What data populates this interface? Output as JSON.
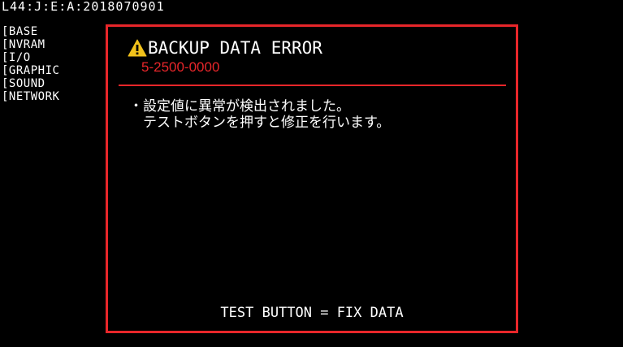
{
  "header": {
    "status_line": "L44:J:E:A:2018070901"
  },
  "menu": {
    "items": [
      {
        "label": "[BASE"
      },
      {
        "label": "[NVRAM"
      },
      {
        "label": "[I/O"
      },
      {
        "label": "[GRAPHIC"
      },
      {
        "label": "[SOUND"
      },
      {
        "label": "[NETWORK"
      }
    ]
  },
  "error_panel": {
    "icon": "warning-icon",
    "title": "BACKUP DATA ERROR",
    "code": "5-2500-0000",
    "message_line1": "・設定値に異常が検出されました。",
    "message_line2": "　テストボタンを押すと修正を行います。",
    "footer": "TEST BUTTON = FIX DATA"
  },
  "colors": {
    "background": "#000000",
    "accent_red": "#e8262a",
    "warning_yellow": "#f2c21b",
    "text": "#ffffff"
  }
}
